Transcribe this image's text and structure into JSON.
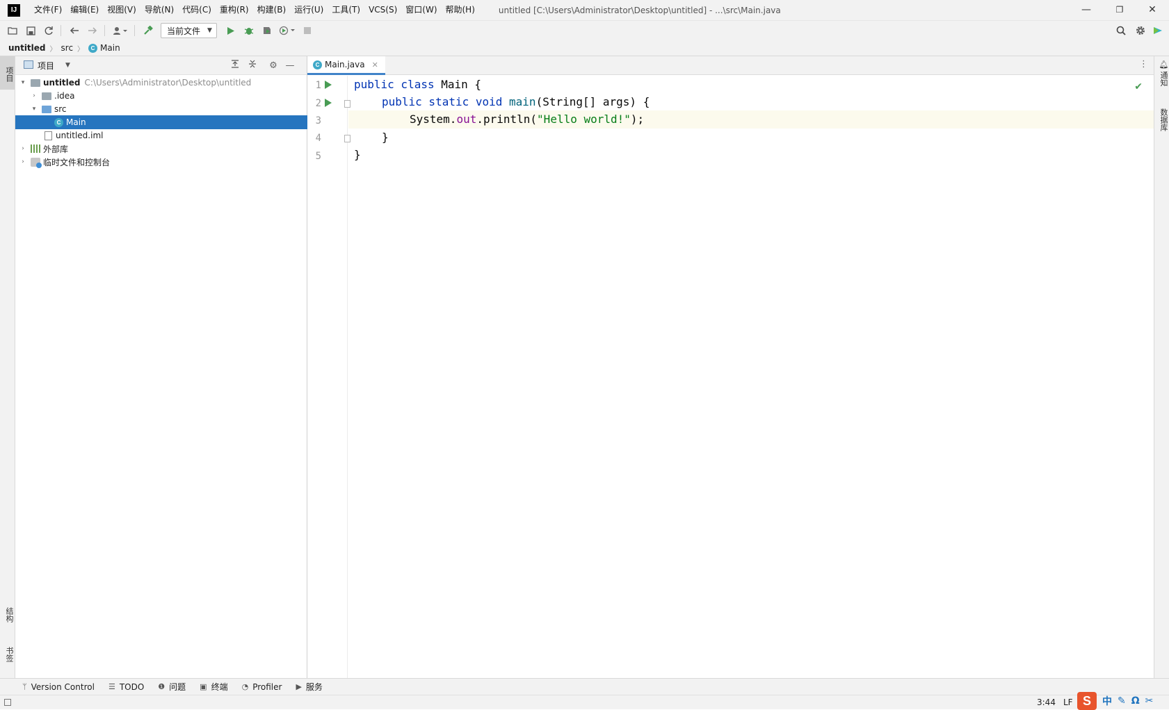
{
  "titlebar": {
    "logo": "IJ",
    "menu": [
      "文件(F)",
      "编辑(E)",
      "视图(V)",
      "导航(N)",
      "代码(C)",
      "重构(R)",
      "构建(B)",
      "运行(U)",
      "工具(T)",
      "VCS(S)",
      "窗口(W)",
      "帮助(H)"
    ],
    "window_title": "untitled [C:\\Users\\Administrator\\Desktop\\untitled] - ...\\src\\Main.java",
    "minimize": "—",
    "restore": "❐",
    "close": "✕"
  },
  "toolbar": {
    "run_config": "当前文件",
    "icons": [
      "open-icon",
      "save-icon",
      "sync-icon",
      "back-icon",
      "forward-icon",
      "user-icon",
      "build-icon",
      "run-icon",
      "debug-icon",
      "coverage-icon",
      "profile-icon",
      "stop-icon",
      "search-icon",
      "settings-icon",
      "plugin-icon"
    ]
  },
  "breadcrumb": {
    "items": [
      "untitled",
      "src",
      "Main"
    ]
  },
  "left_stripe": {
    "project": "项目",
    "structure": "结构",
    "bookmarks": "书签"
  },
  "right_stripe": {
    "notifications": "通知",
    "database": "数据库"
  },
  "project_panel": {
    "title": "项目",
    "tree": [
      {
        "label": "untitled",
        "path": "C:\\Users\\Administrator\\Desktop\\untitled",
        "expanded": true
      },
      {
        "label": ".idea",
        "expanded": false
      },
      {
        "label": "src",
        "expanded": true
      },
      {
        "label": "Main",
        "selected": true
      },
      {
        "label": "untitled.iml"
      },
      {
        "label": "外部库",
        "expanded": false
      },
      {
        "label": "临时文件和控制台",
        "expanded": false
      }
    ]
  },
  "editor": {
    "tab_label": "Main.java",
    "line_numbers": [
      "1",
      "2",
      "3",
      "4",
      "5"
    ],
    "code": {
      "l1_kw": "public class",
      "l1_rest": " Main {",
      "l2_kw": "public static void",
      "l2_fn": "main",
      "l2_rest": "(String[] args) {",
      "l3_a": "System.",
      "l3_fld": "out",
      "l3_b": ".println(",
      "l3_str": "\"Hello world!\"",
      "l3_c": ");",
      "l4": "}",
      "l5": "}"
    },
    "inspection": "✔"
  },
  "bottom_tabs": [
    "Version Control",
    "TODO",
    "问题",
    "终端",
    "Profiler",
    "服务"
  ],
  "status": {
    "caret_pos": "3:44",
    "line_separator": "LF",
    "ime_logo": "S",
    "ime_items": [
      "中",
      "✎",
      "Ω",
      "✂"
    ]
  },
  "colors": {
    "selection": "#2675bf",
    "keyword": "#0033b3",
    "string": "#067d17",
    "run_marker": "#499c54"
  }
}
